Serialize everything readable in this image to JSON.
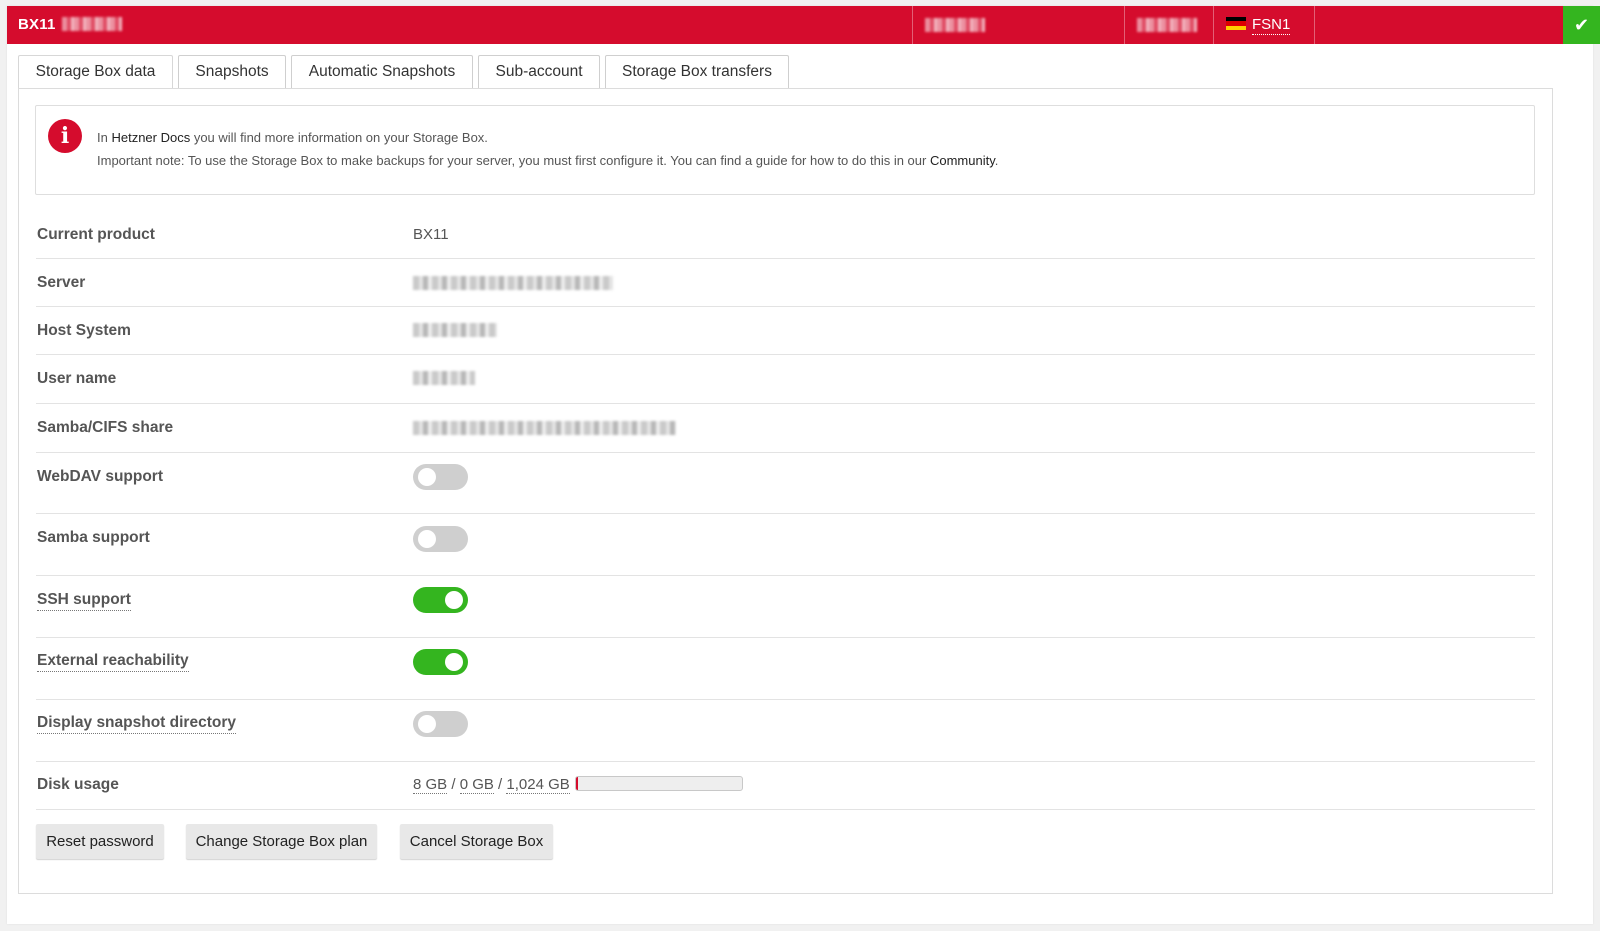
{
  "header": {
    "title": "BX11",
    "location": "FSN1",
    "status_icon": "check-icon",
    "colors": {
      "brand_red": "#d50c2d",
      "success_green": "#34b51f"
    }
  },
  "tabs": [
    {
      "label": "Storage Box data",
      "active": true
    },
    {
      "label": "Snapshots"
    },
    {
      "label": "Automatic Snapshots"
    },
    {
      "label": "Sub-account"
    },
    {
      "label": "Storage Box transfers"
    }
  ],
  "info": {
    "line1_prefix": "In ",
    "line1_link": "Hetzner Docs",
    "line1_suffix": " you will find more information on your Storage Box.",
    "line2_prefix": "Important note: To use the Storage Box to make backups for your server, you must first configure it. You can find a guide for how to do this in our ",
    "line2_link": "Community",
    "line2_suffix": "."
  },
  "details": {
    "current_product_label": "Current product",
    "current_product_value": "BX11",
    "server_label": "Server",
    "host_system_label": "Host System",
    "user_name_label": "User name",
    "samba_share_label": "Samba/CIFS share",
    "webdav_label": "WebDAV support",
    "webdav_enabled": false,
    "samba_label": "Samba support",
    "samba_enabled": false,
    "ssh_label": "SSH support",
    "ssh_enabled": true,
    "external_label": "External reachability",
    "external_enabled": true,
    "snapshot_dir_label": "Display snapshot directory",
    "snapshot_dir_enabled": false,
    "disk_usage_label": "Disk usage",
    "disk_used": "8 GB",
    "disk_snapshots": "0 GB",
    "disk_total": "1,024 GB",
    "disk_usage_fraction": 0.008
  },
  "buttons": {
    "reset_password": "Reset password",
    "change_plan": "Change Storage Box plan",
    "cancel": "Cancel Storage Box"
  }
}
